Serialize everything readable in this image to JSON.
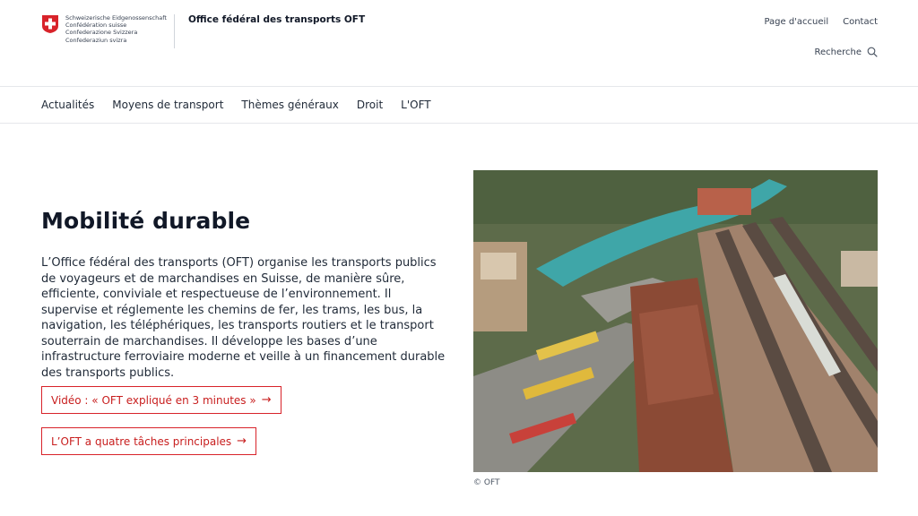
{
  "header": {
    "languages": [
      "Schweizerische Eidgenossenschaft",
      "Confédération suisse",
      "Confederazione Svizzera",
      "Confederaziun svizra"
    ],
    "office_name": "Office fédéral des transports OFT",
    "home_link": "Page d'accueil",
    "contact_link": "Contact",
    "search_label": "Recherche"
  },
  "nav": {
    "items": [
      {
        "label": "Actualités"
      },
      {
        "label": "Moyens de transport"
      },
      {
        "label": "Thèmes généraux"
      },
      {
        "label": "Droit"
      },
      {
        "label": "L'OFT"
      }
    ]
  },
  "hero": {
    "title": "Mobilité durable",
    "lead": "L’Office fédéral des transports (OFT) organise les transports publics de voyageurs et de marchandises en Suisse, de manière sûre, efficiente, conviviale et respectueuse de l’environnement. Il supervise et réglemente les chemins de fer, les trams, les bus, la navigation, les téléphériques, les transports routiers et le transport souterrain de marchandises. Il développe les bases d’une infrastructure ferroviaire moderne et veille à un financement durable des transports publics.",
    "button_video": "Vidéo : « OFT expliqué en 3 minutes »",
    "button_tasks": "L’OFT a quatre tâches principales",
    "arrow": "→",
    "image_credit": "© OFT"
  },
  "colors": {
    "swiss_red": "#d8232a",
    "text": "#1f2937",
    "border": "#e5e7eb"
  },
  "icons": {
    "flag": "swiss-cross-icon",
    "search": "search-icon",
    "arrow": "arrow-right-icon"
  }
}
